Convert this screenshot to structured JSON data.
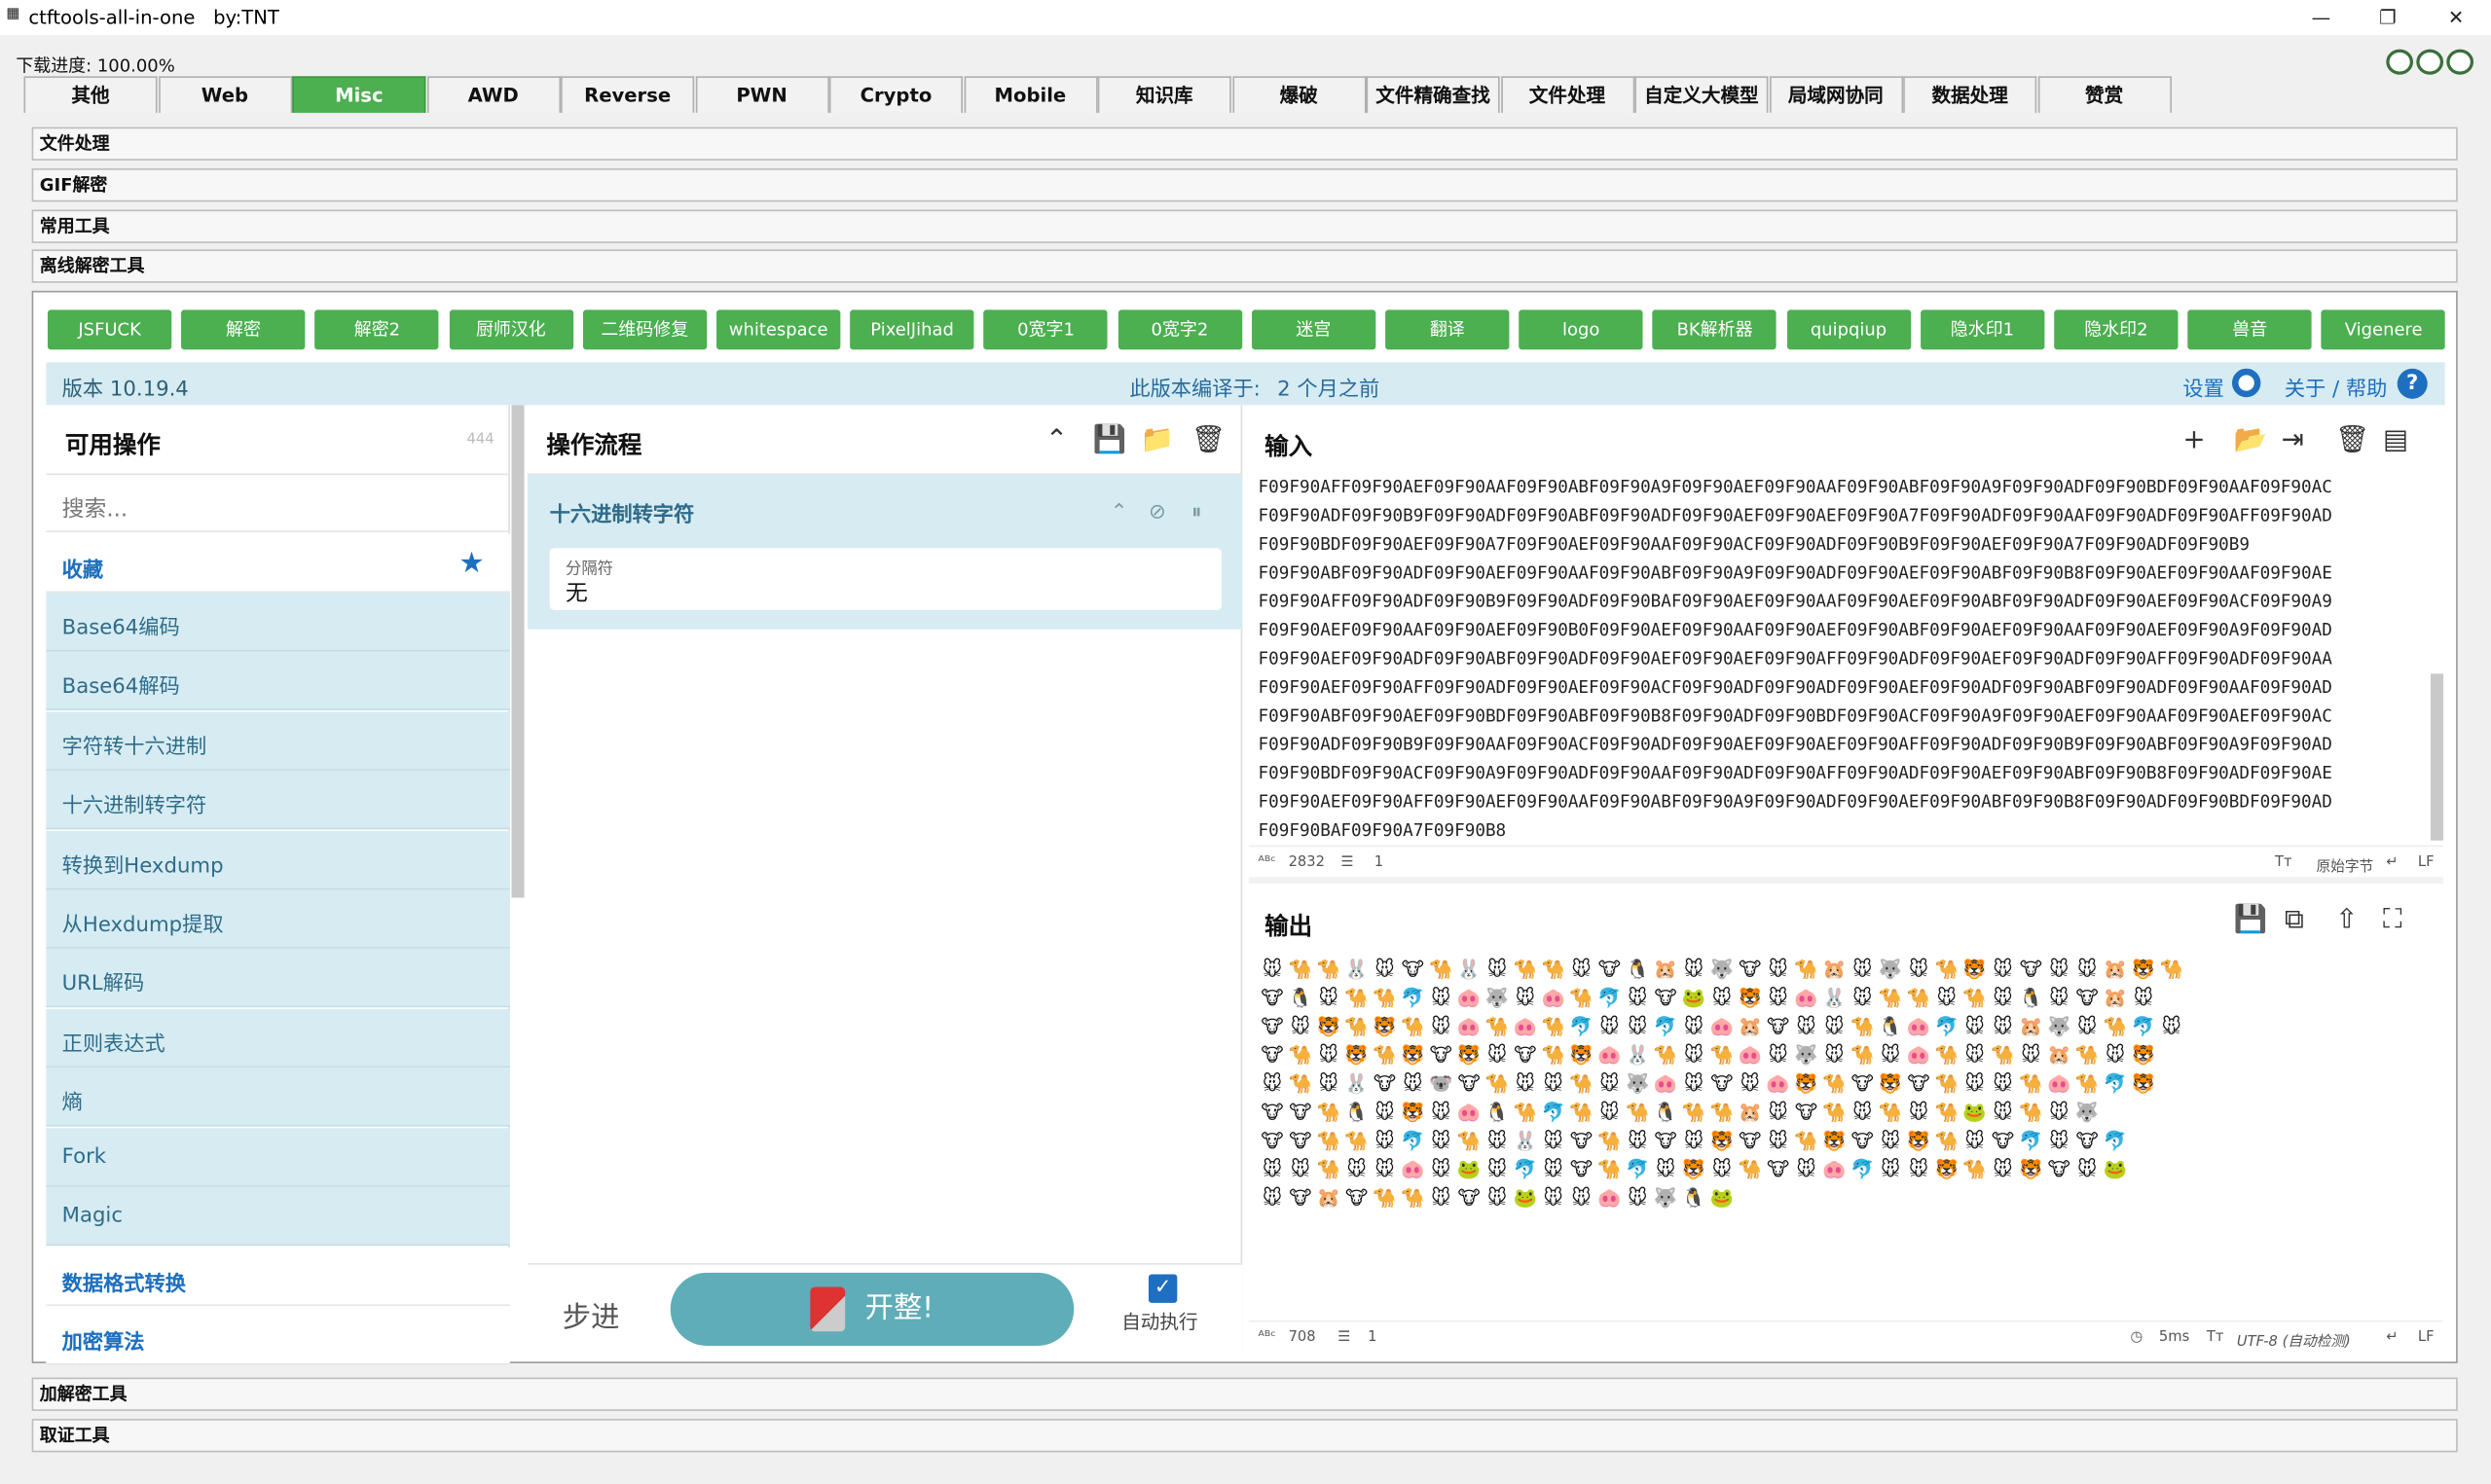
{
  "window": {
    "title": "ctftools-all-in-one   by:TNT",
    "minimize": "—",
    "maximize": "❐",
    "close": "✕"
  },
  "progress": "下载进度: 100.00%",
  "main_tabs": [
    "其他",
    "Web",
    "Misc",
    "AWD",
    "Reverse",
    "PWN",
    "Crypto",
    "Mobile",
    "知识库",
    "爆破",
    "文件精确查找",
    "文件处理",
    "自定义大模型",
    "局域网协同",
    "数据处理",
    "赞赏"
  ],
  "active_tab": "Misc",
  "sections_top": [
    "文件处理",
    "GIF解密",
    "常用工具",
    "离线解密工具"
  ],
  "sections_bottom": [
    "加解密工具",
    "取证工具"
  ],
  "tool_buttons": [
    "JSFUCK",
    "解密",
    "解密2",
    "厨师汉化",
    "二维码修复",
    "whitespace",
    "PixelJihad",
    "0宽字1",
    "0宽字2",
    "迷宫",
    "翻译",
    "logo",
    "BK解析器",
    "quipqiup",
    "隐水印1",
    "隐水印2",
    "兽音",
    "Vigenere"
  ],
  "version_bar": {
    "version": "版本 10.19.4",
    "compiled_label": "此版本编译于:",
    "compiled_value": "2 个月之前",
    "settings": "设置",
    "about": "关于 / 帮助"
  },
  "ops": {
    "title": "可用操作",
    "count": "444",
    "search_placeholder": "搜索...",
    "favorites": "收藏",
    "items": [
      "Base64编码",
      "Base64解码",
      "字符转十六进制",
      "十六进制转字符",
      "转换到Hexdump",
      "从Hexdump提取",
      "URL解码",
      "正则表达式",
      "熵",
      "Fork",
      "Magic"
    ],
    "categories": [
      "数据格式转换",
      "加密算法"
    ]
  },
  "recipe": {
    "title": "操作流程",
    "step_name": "十六进制转字符",
    "delimiter_label": "分隔符",
    "delimiter_value": "无",
    "step_button": "步进",
    "bake_button": "开整!",
    "auto_bake": "自动执行"
  },
  "input": {
    "title": "输入",
    "lines": [
      "F09F90AFF09F90AEF09F90AAF09F90ABF09F90A9F09F90AEF09F90AAF09F90ABF09F90A9F09F90ADF09F90BDF09F90AAF09F90AC",
      "F09F90ADF09F90B9F09F90ADF09F90ABF09F90ADF09F90AEF09F90AEF09F90A7F09F90ADF09F90AAF09F90ADF09F90AFF09F90AD",
      "F09F90BDF09F90AEF09F90A7F09F90AEF09F90AAF09F90ACF09F90ADF09F90B9F09F90AEF09F90A7F09F90ADF09F90B9",
      "F09F90ABF09F90ADF09F90AEF09F90AAF09F90ABF09F90A9F09F90ADF09F90AEF09F90ABF09F90B8F09F90AEF09F90AAF09F90AE",
      "F09F90AFF09F90ADF09F90B9F09F90ADF09F90BAF09F90AEF09F90AAF09F90AEF09F90ABF09F90ADF09F90AEF09F90ACF09F90A9",
      "F09F90AEF09F90AAF09F90AEF09F90B0F09F90AEF09F90AAF09F90AEF09F90ABF09F90AEF09F90AAF09F90AEF09F90A9F09F90AD",
      "F09F90AEF09F90ADF09F90ABF09F90ADF09F90AEF09F90AEF09F90AFF09F90ADF09F90AEF09F90ADF09F90AFF09F90ADF09F90AA",
      "F09F90AEF09F90AFF09F90ADF09F90AEF09F90ACF09F90ADF09F90ADF09F90AEF09F90ADF09F90ABF09F90ADF09F90AAF09F90AD",
      "F09F90ABF09F90AEF09F90BDF09F90ABF09F90B8F09F90ADF09F90BDF09F90ACF09F90A9F09F90AEF09F90AAF09F90AEF09F90AC",
      "F09F90ADF09F90B9F09F90AAF09F90ACF09F90ADF09F90AEF09F90AEF09F90AFF09F90ADF09F90B9F09F90ABF09F90A9F09F90AD",
      "F09F90BDF09F90ACF09F90A9F09F90ADF09F90AAF09F90ADF09F90AFF09F90ADF09F90AEF09F90ABF09F90B8F09F90ADF09F90AE",
      "F09F90AEF09F90AFF09F90AEF09F90AAF09F90ABF09F90A9F09F90ADF09F90AEF09F90ABF09F90B8F09F90ADF09F90BDF09F90AD",
      "F09F90BAF09F90A7F09F90B8"
    ],
    "length": "2832",
    "lines_count": "1",
    "raw_bytes": "原始字节",
    "eol": "LF"
  },
  "output": {
    "title": "输出",
    "emoji_rows": [
      "🐭🐪🐪🐰🐭🐮🐪🐰🐭🐪🐪🐭🐮🐧🐹🐭🐺🐮🐭🐪🐹🐭🐺🐭🐪🐯🐭🐮🐭🐭🐹🐯🐪",
      "🐮🐧🐭🐪🐪🐬🐭🐽🐺🐭🐽🐪🐬🐭🐮🐸🐭🐯🐭🐽🐰🐭🐪🐪🐭🐪🐭🐧🐭🐮🐹🐭",
      "🐮🐭🐯🐪🐯🐪🐭🐽🐪🐽🐪🐬🐭🐭🐬🐭🐽🐹🐮🐭🐭🐪🐧🐽🐬🐭🐭🐹🐺🐭🐪🐬🐭",
      "🐮🐪🐭🐯🐪🐯🐮🐯🐭🐮🐪🐯🐽🐰🐪🐭🐪🐽🐭🐺🐭🐪🐭🐽🐪🐭🐪🐭🐹🐪🐭🐯",
      "🐭🐪🐭🐰🐮🐭🐨🐮🐪🐭🐭🐪🐭🐺🐽🐭🐮🐭🐽🐯🐪🐮🐯🐮🐪🐭🐭🐪🐽🐪🐬🐯",
      "🐮🐮🐪🐧🐭🐯🐭🐽🐧🐪🐬🐪🐭🐪🐧🐪🐪🐹🐭🐮🐪🐭🐪🐭🐪🐸🐭🐪🐭🐺",
      "🐮🐮🐪🐪🐭🐬🐭🐪🐭🐰🐭🐮🐪🐭🐮🐭🐯🐮🐭🐪🐯🐮🐭🐯🐪🐭🐮🐬🐭🐮🐬",
      "🐭🐭🐪🐭🐭🐽🐭🐸🐭🐬🐭🐮🐪🐬🐭🐯🐭🐪🐮🐭🐽🐬🐭🐭🐯🐪🐭🐯🐮🐭🐸",
      "🐭🐮🐹🐮🐪🐪🐭🐮🐭🐸🐭🐭🐽🐭🐺🐧🐸"
    ],
    "length": "708",
    "lines_count": "1",
    "time": "5ms",
    "encoding": "UTF-8 (自动检测)",
    "eol": "LF"
  },
  "colors": {
    "tab_active": "#4caf50",
    "panel_blue": "#d6ecf2",
    "link_blue": "#1e6fbf",
    "bake": "#5fadb8"
  }
}
